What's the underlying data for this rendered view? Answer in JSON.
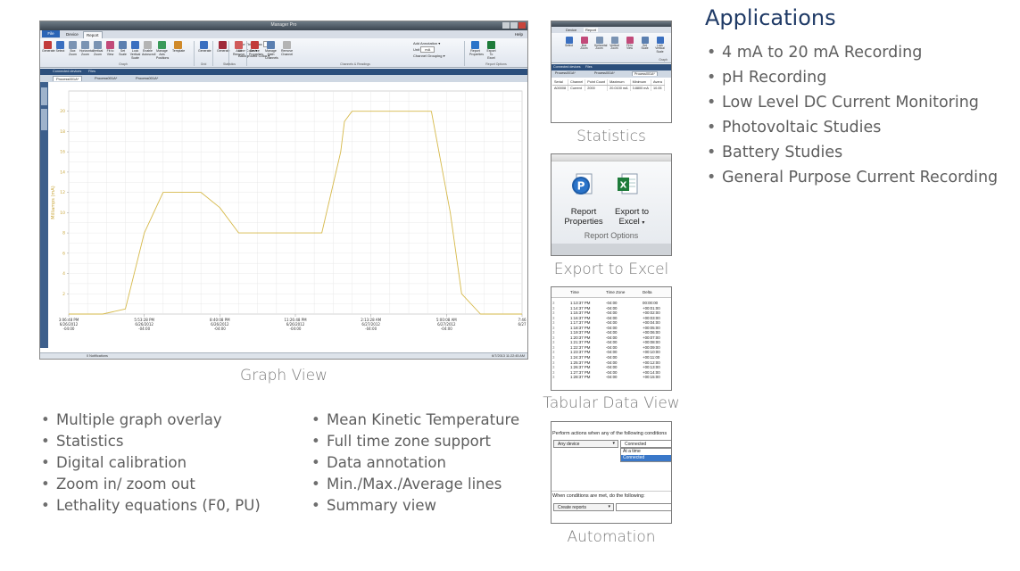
{
  "graph_window": {
    "title": "Manager Pro",
    "tabs": {
      "file": "File",
      "device": "Device",
      "report": "Report",
      "help": "Help"
    },
    "ribbon_buttons": [
      "Generate",
      "Select",
      "Box Zoom",
      "Horizontal Zoom",
      "Vertical Zoom",
      "Fit to View",
      "Set Scale",
      "Lock Vertical Scale",
      "Enable Autoscroll",
      "Manage Axis Positions",
      "Template",
      "Generate",
      "Generate",
      "Add Remove",
      "Device Properties",
      "Manage Math Channels",
      "Remove Channel",
      "Report Properties",
      "Export To Excel"
    ],
    "ribbon_controls": {
      "line_thickness": "Line Thickness",
      "line_thickness_value": "1",
      "line_color": "Line Color",
      "background_color": "Background Color",
      "add_annotation": "Add Annotation",
      "unit_label": "Unit",
      "unit_value": "mA",
      "channel_grouping": "Channel Grouping"
    },
    "ribbon_groups": [
      "Graph",
      "Grid",
      "Statistics",
      "Channels & Readings",
      "Report Options"
    ],
    "sub_tabs": [
      "Connected devices",
      "Files"
    ],
    "doc_tabs": [
      "Process001A*",
      "Process001A*",
      "Process001A*"
    ],
    "side_tabs": [
      "Devices",
      "Files/Reports"
    ],
    "status_left": "0 Notifications",
    "status_right": "6/7/2013 11:22:45 AM"
  },
  "chart_data": {
    "type": "line",
    "ylabel": "Milliamps (mA)",
    "ylim": [
      0,
      22
    ],
    "yticks": [
      2,
      4,
      6,
      8,
      10,
      12,
      14,
      16,
      18,
      20
    ],
    "x_ticks": [
      {
        "time": "3:06:48 PM",
        "date": "6/26/2012",
        "tz": "-04:00"
      },
      {
        "time": "5:53:28 PM",
        "date": "6/26/2012",
        "tz": "-04:00"
      },
      {
        "time": "8:40:08 PM",
        "date": "6/26/2012",
        "tz": "-04:00"
      },
      {
        "time": "11:26:48 PM",
        "date": "6/26/2012",
        "tz": "-04:00"
      },
      {
        "time": "2:13:28 AM",
        "date": "6/27/2012",
        "tz": "-04:00"
      },
      {
        "time": "5:00:08 AM",
        "date": "6/27/2012",
        "tz": "-04:00"
      },
      {
        "time": "7:46",
        "date": "6/27",
        "tz": ""
      }
    ],
    "series": [
      {
        "color": "#d6b94a",
        "x": [
          0,
          0.45,
          0.75,
          1.0,
          1.25,
          1.5,
          1.75,
          2.0,
          2.25,
          2.5,
          2.75,
          3.0,
          3.35,
          3.6,
          3.65,
          3.75,
          4.0,
          4.25,
          4.5,
          4.8,
          4.95,
          5.05,
          5.2,
          5.45,
          5.75,
          6.0
        ],
        "y": [
          0,
          0,
          0.5,
          8.0,
          12.0,
          12.0,
          12.0,
          10.5,
          8.0,
          8.0,
          8.0,
          8.0,
          8.0,
          16.0,
          19.0,
          20.0,
          20.0,
          20.0,
          20.0,
          20.0,
          14.0,
          10.0,
          2.0,
          0,
          0,
          0
        ]
      }
    ],
    "grid": true
  },
  "captions": {
    "graph": "Graph View",
    "statistics": "Statistics",
    "export": "Export to Excel",
    "tabular": "Tabular Data View",
    "automation": "Automation"
  },
  "features_left": [
    "Multiple graph overlay",
    "Statistics",
    "Digital calibration",
    "Zoom in/ zoom out",
    "Lethality equations (F0, PU)"
  ],
  "features_right": [
    "Mean Kinetic Temperature",
    "Full time zone support",
    "Data annotation",
    "Min./Max./Average lines",
    "Summary view"
  ],
  "applications": {
    "title": "Applications",
    "items": [
      "4 mA to 20 mA Recording",
      "pH Recording",
      "Low Level DC Current Monitoring",
      "Photovoltaic Studies",
      "Battery Studies",
      "General Purpose Current Recording"
    ]
  },
  "stats_thumb": {
    "tabs": [
      "Device",
      "Report"
    ],
    "group": "Graph",
    "ribbon_buttons": [
      "Select",
      "Box Zoom",
      "Horizontal Zoom",
      "Vertical Zoom",
      "Fit to View",
      "Set Scale",
      "Lock Vertical Scale"
    ],
    "sub_tabs": [
      "Connected devices",
      "Files"
    ],
    "doc_tabs": [
      "Process001A*",
      "Process001A*",
      "Process001A*"
    ],
    "headers": [
      "Serial",
      "Channel",
      "Point Count",
      "Maximum",
      "Minimum",
      "Avera"
    ],
    "row": [
      "A00008",
      "Current",
      "2000",
      "20.0100 mA",
      "3.8800 mA",
      "10.05"
    ]
  },
  "export_thumb": {
    "report_label_1": "Report",
    "report_label_2": "Properties",
    "excel_label_1": "Export to",
    "excel_label_2": "Excel",
    "group": "Report Options"
  },
  "table_thumb": {
    "headers": [
      "Time",
      "Time Zone",
      "Delta"
    ],
    "rows": [
      [
        "1:13:37 PM",
        "-04:00",
        "00:00:00"
      ],
      [
        "1:14:37 PM",
        "-04:00",
        "+00:01:00"
      ],
      [
        "1:15:37 PM",
        "-04:00",
        "+00:02:00"
      ],
      [
        "1:16:37 PM",
        "-04:00",
        "+00:03:00"
      ],
      [
        "1:17:37 PM",
        "-04:00",
        "+00:04:00"
      ],
      [
        "1:18:37 PM",
        "-04:00",
        "+00:05:00"
      ],
      [
        "1:19:37 PM",
        "-04:00",
        "+00:06:00"
      ],
      [
        "1:20:37 PM",
        "-04:00",
        "+00:07:00"
      ],
      [
        "1:21:37 PM",
        "-04:00",
        "+00:08:00"
      ],
      [
        "1:22:37 PM",
        "-04:00",
        "+00:09:00"
      ],
      [
        "1:23:37 PM",
        "-04:00",
        "+00:10:00"
      ],
      [
        "1:24:37 PM",
        "-04:00",
        "+00:11:00"
      ],
      [
        "1:25:37 PM",
        "-04:00",
        "+00:12:00"
      ],
      [
        "1:26:37 PM",
        "-04:00",
        "+00:13:00"
      ],
      [
        "1:27:37 PM",
        "-04:00",
        "+00:14:00"
      ],
      [
        "1:28:37 PM",
        "-04:00",
        "+00:15:00"
      ]
    ]
  },
  "automation_thumb": {
    "prompt": "Perform actions when any of the following conditions",
    "device_select": "Any device",
    "condition_select": "Connected",
    "dropdown_options": [
      "At a time",
      "Connected"
    ],
    "then_text": "When conditions are met, do the following:",
    "action_select": "Create reports"
  }
}
